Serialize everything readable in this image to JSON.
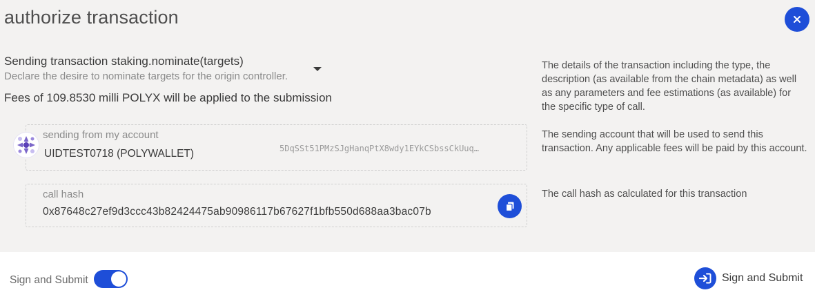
{
  "modal": {
    "title": "authorize transaction",
    "close_icon": "close-icon"
  },
  "transaction": {
    "title": "Sending transaction staking.nominate(targets)",
    "description": "Declare the desire to nominate targets for the origin controller.",
    "fees": "Fees of 109.8530 milli POLYX will be applied to the submission"
  },
  "help": {
    "details": "The details of the transaction including the type, the description (as available from the chain metadata) as well as any parameters and fee estimations (as available) for the specific type of call.",
    "account": "The sending account that will be used to send this transaction. Any applicable fees will be paid by this account.",
    "hash": "The call hash as calculated for this transaction"
  },
  "account": {
    "label": "sending from my account",
    "name": "UIDTEST0718 (POLYWALLET)",
    "address": "5DqSSt51PMzSJgHanqPtX8wdy1EYkCSbssCkUuq…"
  },
  "call_hash": {
    "label": "call hash",
    "value": "0x87648c27ef9d3ccc43b82424475ab90986117b67627f1bfb550d688aa3bac07b"
  },
  "footer": {
    "toggle_label": "Sign and Submit",
    "toggle_on": true,
    "submit_label": "Sign and Submit"
  },
  "colors": {
    "accent": "#1e4ed8",
    "panel_bg": "#f3f2f1"
  }
}
